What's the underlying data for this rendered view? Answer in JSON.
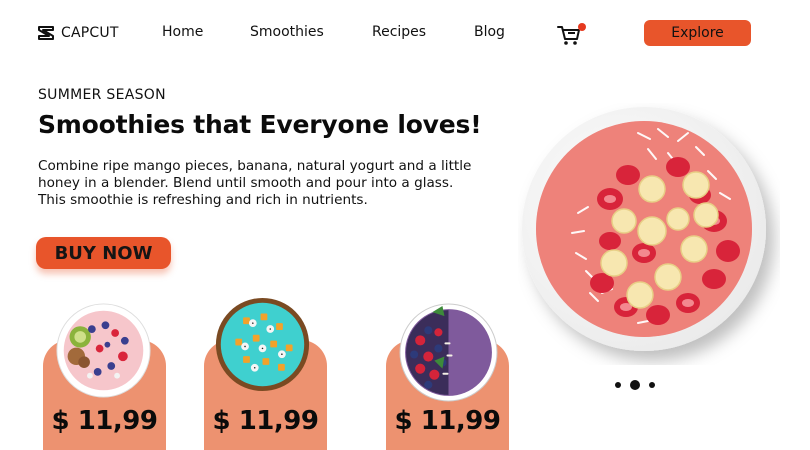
{
  "brand": {
    "name": "CAPCUT",
    "logo_icon": "capcut-logo-icon"
  },
  "nav": {
    "items": [
      {
        "label": "Home"
      },
      {
        "label": "Smoothies"
      },
      {
        "label": "Recipes"
      },
      {
        "label": "Blog"
      }
    ]
  },
  "cart": {
    "icon": "cart-icon",
    "badge_color": "#e5391f"
  },
  "header": {
    "explore_label": "Explore"
  },
  "hero": {
    "kicker": "SUMMER SEASON",
    "title": "Smoothies that Everyone loves!",
    "description": "Combine ripe mango pieces, banana, natural yogurt and a little honey in a blender. Blend until smooth and pour into a glass. This smoothie is refreshing and rich in nutrients.",
    "cta_label": "BUY NOW"
  },
  "products": [
    {
      "price": "$ 11,99",
      "image": "pink-berry-granola-bowl"
    },
    {
      "price": "$ 11,99",
      "image": "blue-spirulina-mango-bowl"
    },
    {
      "price": "$ 11,99",
      "image": "purple-acai-berry-bowl"
    }
  ],
  "carousel": {
    "count": 3,
    "active_index": 1
  },
  "colors": {
    "accent": "#e8552b",
    "card": "#ed9270",
    "text": "#111111"
  }
}
